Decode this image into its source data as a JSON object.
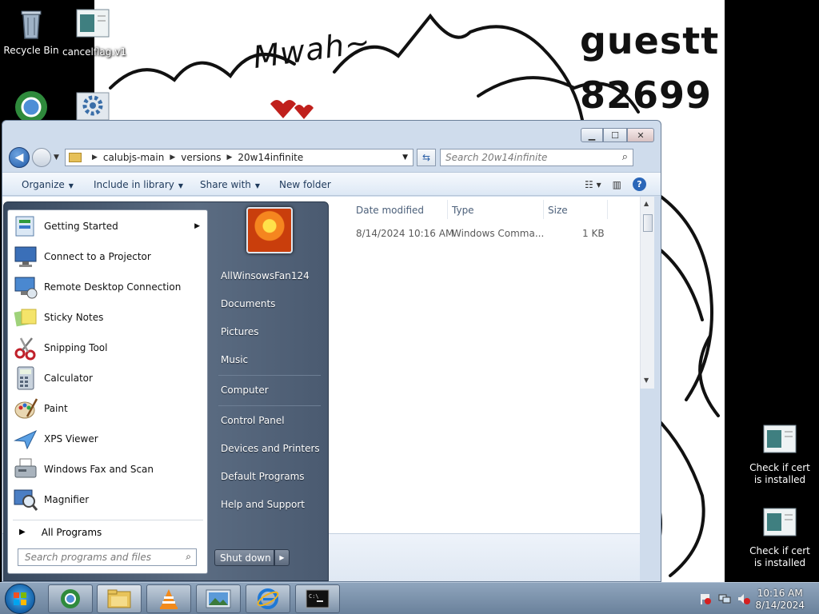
{
  "desktop": {
    "icons": [
      {
        "label": "Recycle Bin"
      },
      {
        "label": "cancelflag.v1"
      },
      {
        "label": "Check if cert is installed"
      },
      {
        "label": "Check if cert is installed"
      }
    ],
    "wallpaper_texts": [
      "Mwah~",
      "guestt",
      "82699"
    ]
  },
  "explorer": {
    "path": [
      "calubjs-main",
      "versions",
      "20w14infinite"
    ],
    "search_placeholder": "Search 20w14infinite",
    "commands": [
      "Organize",
      "Include in library",
      "Share with",
      "New folder"
    ],
    "columns": [
      "Date modified",
      "Type",
      "Size"
    ],
    "rows": [
      {
        "date_modified": "8/14/2024 10:16 AM",
        "type": "Windows Comma...",
        "size": "1 KB"
      }
    ]
  },
  "start_menu": {
    "programs": [
      {
        "label": "Getting Started",
        "icon": "getting-started-icon",
        "has_submenu": true
      },
      {
        "label": "Connect to a Projector",
        "icon": "projector-icon"
      },
      {
        "label": "Remote Desktop Connection",
        "icon": "remote-desktop-icon"
      },
      {
        "label": "Sticky Notes",
        "icon": "sticky-notes-icon"
      },
      {
        "label": "Snipping Tool",
        "icon": "scissors-icon"
      },
      {
        "label": "Calculator",
        "icon": "calculator-icon"
      },
      {
        "label": "Paint",
        "icon": "paint-palette-icon"
      },
      {
        "label": "XPS Viewer",
        "icon": "xps-viewer-icon"
      },
      {
        "label": "Windows Fax and Scan",
        "icon": "fax-icon"
      },
      {
        "label": "Magnifier",
        "icon": "magnifier-icon"
      }
    ],
    "all_programs": "All Programs",
    "search_placeholder": "Search programs and files",
    "right_items": [
      "AllWinsowsFan124",
      "Documents",
      "Pictures",
      "Music",
      "Computer",
      "Control Panel",
      "Devices and Printers",
      "Default Programs",
      "Help and Support"
    ],
    "shutdown_label": "Shut down"
  },
  "taskbar": {
    "clock_time": "10:16 AM",
    "clock_date": "8/14/2024"
  }
}
